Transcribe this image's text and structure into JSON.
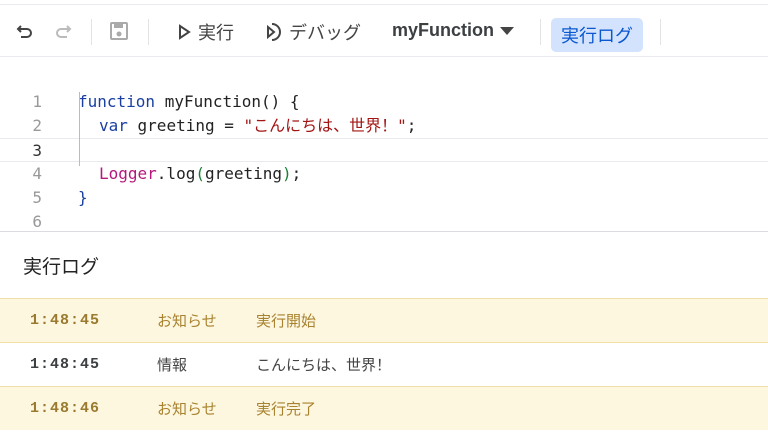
{
  "toolbar": {
    "undo_icon": "undo-icon",
    "redo_icon": "redo-icon",
    "save_icon": "save-icon",
    "run_label": "実行",
    "debug_label": "デバッグ",
    "function_select": "myFunction",
    "log_button": "実行ログ"
  },
  "editor": {
    "line_numbers": [
      "1",
      "2",
      "3",
      "4",
      "5",
      "6"
    ],
    "l1": {
      "kw": "function",
      "rest": " myFunction() {"
    },
    "l2": {
      "kw": "var",
      "mid": " greeting = ",
      "str": "\"こんにちは、世界！\"",
      "end": ";"
    },
    "l4": {
      "obj": "Logger",
      "mid": ".log",
      "p1": "(",
      "arg": "greeting",
      "p2": ")",
      "end": ";"
    },
    "l5": "}"
  },
  "log": {
    "title": "実行ログ",
    "rows": [
      {
        "time": "1:48:45",
        "level": "お知らせ",
        "message": "実行開始"
      },
      {
        "time": "1:48:45",
        "level": "情報",
        "message": "こんにちは、世界！"
      },
      {
        "time": "1:48:46",
        "level": "お知らせ",
        "message": "実行完了"
      }
    ]
  },
  "colors": {
    "notice_bg": "#fef7e0",
    "accent": "#d3e3fd"
  }
}
